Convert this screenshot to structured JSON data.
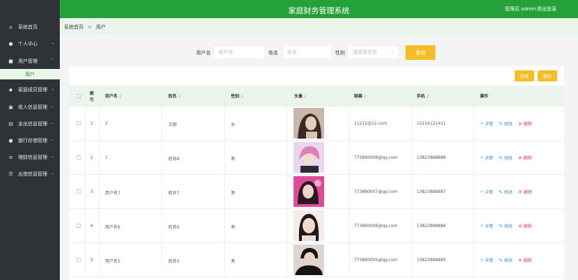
{
  "app": {
    "title": "家庭财务管理系统",
    "user_label": "管理员 admin",
    "logout": "退出登录"
  },
  "sidebar": {
    "items": [
      {
        "label": "系统首页",
        "icon": "home-icon"
      },
      {
        "label": "个人中心",
        "icon": "user-icon"
      },
      {
        "label": "用户管理",
        "icon": "chat-icon"
      },
      {
        "label": "家庭成员管理",
        "icon": "shield-icon"
      },
      {
        "label": "收入信息管理",
        "icon": "briefcase-icon"
      },
      {
        "label": "支出信息管理",
        "icon": "card-icon"
      },
      {
        "label": "银行存储管理",
        "icon": "pin-icon"
      },
      {
        "label": "理财信息管理",
        "icon": "sliders-icon"
      },
      {
        "label": "出借信息管理",
        "icon": "list-icon"
      }
    ],
    "sub_active": "用户"
  },
  "breadcrumb": {
    "home": "系统首页",
    "sep": ">",
    "current": "用户"
  },
  "search": {
    "username_label": "用户名",
    "username_placeholder": "用户名",
    "name_label": "姓名",
    "name_placeholder": "姓名",
    "gender_label": "性别",
    "gender_placeholder": "请选择性别",
    "query_button": "查询"
  },
  "toolbar": {
    "add": "新增",
    "delete": "删除"
  },
  "table": {
    "headers": {
      "index": "索引",
      "username": "用户名",
      "name": "姓名",
      "gender": "性别",
      "avatar": "头像",
      "email": "邮箱",
      "phone": "手机",
      "actions": "操作"
    },
    "action_labels": {
      "view": "详情",
      "edit": "修改",
      "delete": "删除"
    },
    "rows": [
      {
        "index": "1",
        "username": "2",
        "name": "王丽",
        "gender": "女",
        "email": "11212@12.com",
        "phone": "15214121411"
      },
      {
        "index": "2",
        "username": "1",
        "name": "姓名8",
        "gender": "男",
        "email": "773890008@qq.com",
        "phone": "13823888888"
      },
      {
        "index": "3",
        "username": "用户名7",
        "name": "姓名7",
        "gender": "男",
        "email": "773890007@qq.com",
        "phone": "13823888887"
      },
      {
        "index": "4",
        "username": "用户名6",
        "name": "姓名6",
        "gender": "男",
        "email": "773890006@qq.com",
        "phone": "13823888886"
      },
      {
        "index": "5",
        "username": "用户名5",
        "name": "姓名5",
        "gender": "男",
        "email": "773890005@qq.com",
        "phone": "13823888885"
      }
    ]
  },
  "colors": {
    "header_green": "#25a13a",
    "sidebar_dark": "#2f3237",
    "accent_yellow": "#f5bd26",
    "light_green": "#e9f5ea"
  }
}
